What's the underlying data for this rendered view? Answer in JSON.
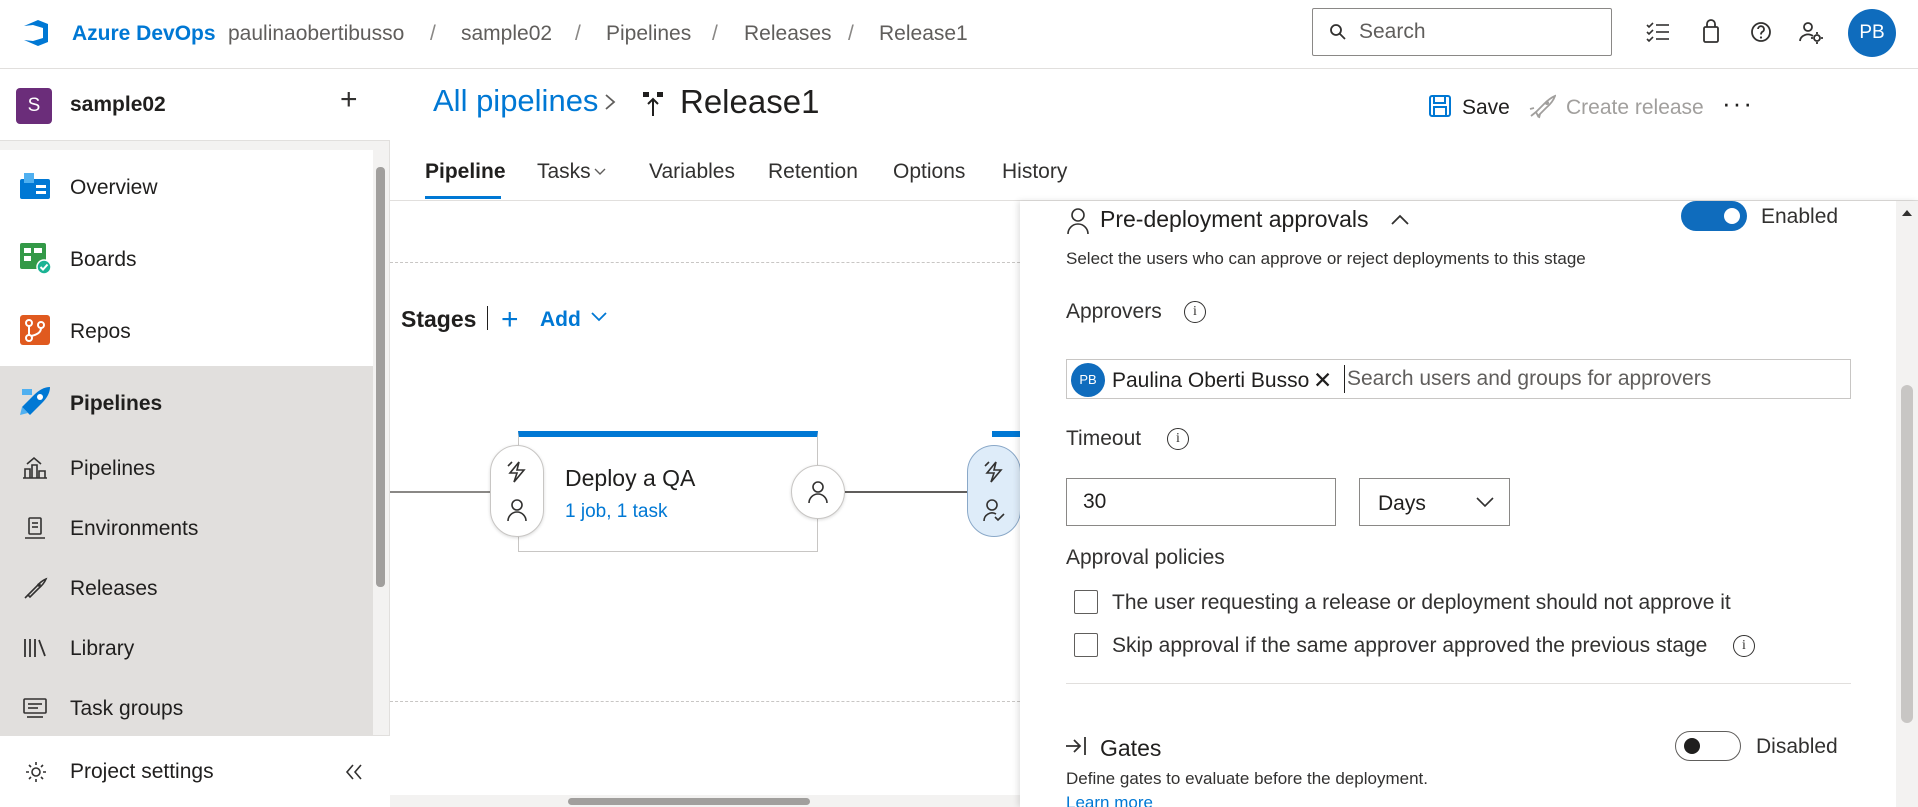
{
  "topbar": {
    "brand": "Azure DevOps",
    "breadcrumbs": [
      "paulinaobertibusso",
      "sample02",
      "Pipelines",
      "Releases",
      "Release1"
    ],
    "search_placeholder": "Search",
    "avatar_initials": "PB",
    "icons": [
      "work-items-icon",
      "marketplace-bag-icon",
      "help-icon",
      "user-settings-icon"
    ]
  },
  "sidebar": {
    "project_initial": "S",
    "project_name": "sample02",
    "items": [
      {
        "label": "Overview",
        "icon": "overview-icon"
      },
      {
        "label": "Boards",
        "icon": "boards-icon"
      },
      {
        "label": "Repos",
        "icon": "repos-icon"
      },
      {
        "label": "Pipelines",
        "icon": "pipelines-icon",
        "selected": true
      },
      {
        "label": "Pipelines",
        "icon": "pipelines-sub-icon"
      },
      {
        "label": "Environments",
        "icon": "environments-icon"
      },
      {
        "label": "Releases",
        "icon": "releases-icon"
      },
      {
        "label": "Library",
        "icon": "library-icon"
      },
      {
        "label": "Task groups",
        "icon": "task-groups-icon"
      }
    ],
    "settings_label": "Project settings"
  },
  "header": {
    "all_pipelines": "All pipelines",
    "title": "Release1",
    "save_label": "Save",
    "create_release_label": "Create release",
    "more_label": "···",
    "tabs": [
      "Pipeline",
      "Tasks",
      "Variables",
      "Retention",
      "Options",
      "History"
    ]
  },
  "canvas": {
    "stages_label": "Stages",
    "add_label": "Add",
    "stage_name": "Deploy a QA",
    "stage_sub": "1 job, 1 task"
  },
  "panel": {
    "title": "Pre-deployment approvals",
    "enabled_label": "Enabled",
    "description": "Select the users who can approve or reject deployments to this stage",
    "approvers_label": "Approvers",
    "approver_initials": "PB",
    "approver_name": "Paulina Oberti Busso",
    "approvers_placeholder": "Search users and groups for approvers",
    "timeout_label": "Timeout",
    "timeout_value": "30",
    "timeout_unit": "Days",
    "policies_label": "Approval policies",
    "policy_1": "The user requesting a release or deployment should not approve it",
    "policy_2": "Skip approval if the same approver approved the previous stage",
    "gates_title": "Gates",
    "gates_state": "Disabled",
    "gates_desc": "Define gates to evaluate before the deployment.",
    "learn_more": "Learn more"
  },
  "colors": {
    "accent": "#0078d4",
    "toggle_on": "#0f6cbd",
    "project_badge": "#6b2d7a"
  }
}
